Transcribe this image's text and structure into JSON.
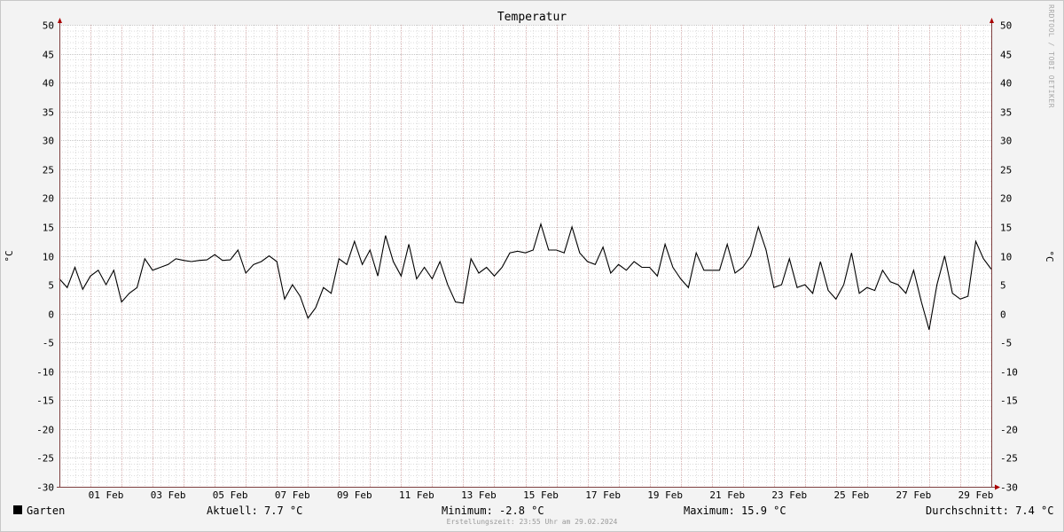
{
  "chart_data": {
    "type": "line",
    "title": "Temperatur",
    "ylabel": "°C",
    "ylabel_right": "°C",
    "ylim": [
      -30,
      50
    ],
    "ytick_step": 5,
    "xlim": [
      "2024-01-31",
      "2024-03-01"
    ],
    "x_ticks": [
      "01 Feb",
      "03 Feb",
      "05 Feb",
      "07 Feb",
      "09 Feb",
      "11 Feb",
      "13 Feb",
      "15 Feb",
      "17 Feb",
      "19 Feb",
      "21 Feb",
      "23 Feb",
      "25 Feb",
      "27 Feb",
      "29 Feb"
    ],
    "grid": true,
    "colors": {
      "line": "#000000",
      "minor_grid": "#c8c8c8",
      "major_grid_x": "#d9a3a3",
      "major_grid_y": "#b5b5b5",
      "axis": "#7f3f3f",
      "arrow": "#aa0000",
      "background": "#ffffff"
    },
    "series": [
      {
        "name": "Garten",
        "x": [
          "2024-01-31 00:00",
          "2024-01-31 06:00",
          "2024-01-31 12:00",
          "2024-01-31 18:00",
          "2024-02-01 00:00",
          "2024-02-01 06:00",
          "2024-02-01 12:00",
          "2024-02-01 18:00",
          "2024-02-02 00:00",
          "2024-02-02 06:00",
          "2024-02-02 12:00",
          "2024-02-02 18:00",
          "2024-02-03 00:00",
          "2024-02-03 06:00",
          "2024-02-03 12:00",
          "2024-02-03 18:00",
          "2024-02-04 00:00",
          "2024-02-04 06:00",
          "2024-02-04 12:00",
          "2024-02-04 18:00",
          "2024-02-05 00:00",
          "2024-02-05 06:00",
          "2024-02-05 12:00",
          "2024-02-05 18:00",
          "2024-02-06 00:00",
          "2024-02-06 06:00",
          "2024-02-06 12:00",
          "2024-02-06 18:00",
          "2024-02-07 00:00",
          "2024-02-07 06:00",
          "2024-02-07 12:00",
          "2024-02-07 18:00",
          "2024-02-08 00:00",
          "2024-02-08 06:00",
          "2024-02-08 12:00",
          "2024-02-08 18:00",
          "2024-02-09 00:00",
          "2024-02-09 06:00",
          "2024-02-09 12:00",
          "2024-02-09 18:00",
          "2024-02-10 00:00",
          "2024-02-10 06:00",
          "2024-02-10 12:00",
          "2024-02-10 18:00",
          "2024-02-11 00:00",
          "2024-02-11 06:00",
          "2024-02-11 12:00",
          "2024-02-11 18:00",
          "2024-02-12 00:00",
          "2024-02-12 06:00",
          "2024-02-12 12:00",
          "2024-02-12 18:00",
          "2024-02-13 00:00",
          "2024-02-13 06:00",
          "2024-02-13 12:00",
          "2024-02-13 18:00",
          "2024-02-14 00:00",
          "2024-02-14 06:00",
          "2024-02-14 12:00",
          "2024-02-14 18:00",
          "2024-02-15 00:00",
          "2024-02-15 06:00",
          "2024-02-15 12:00",
          "2024-02-15 18:00",
          "2024-02-16 00:00",
          "2024-02-16 06:00",
          "2024-02-16 12:00",
          "2024-02-16 18:00",
          "2024-02-17 00:00",
          "2024-02-17 06:00",
          "2024-02-17 12:00",
          "2024-02-17 18:00",
          "2024-02-18 00:00",
          "2024-02-18 06:00",
          "2024-02-18 12:00",
          "2024-02-18 18:00",
          "2024-02-19 00:00",
          "2024-02-19 06:00",
          "2024-02-19 12:00",
          "2024-02-19 18:00",
          "2024-02-20 00:00",
          "2024-02-20 06:00",
          "2024-02-20 12:00",
          "2024-02-20 18:00",
          "2024-02-21 00:00",
          "2024-02-21 06:00",
          "2024-02-21 12:00",
          "2024-02-21 18:00",
          "2024-02-22 00:00",
          "2024-02-22 06:00",
          "2024-02-22 12:00",
          "2024-02-22 18:00",
          "2024-02-23 00:00",
          "2024-02-23 06:00",
          "2024-02-23 12:00",
          "2024-02-23 18:00",
          "2024-02-24 00:00",
          "2024-02-24 06:00",
          "2024-02-24 12:00",
          "2024-02-24 18:00",
          "2024-02-25 00:00",
          "2024-02-25 06:00",
          "2024-02-25 12:00",
          "2024-02-25 18:00",
          "2024-02-26 00:00",
          "2024-02-26 06:00",
          "2024-02-26 12:00",
          "2024-02-26 18:00",
          "2024-02-27 00:00",
          "2024-02-27 06:00",
          "2024-02-27 12:00",
          "2024-02-27 18:00",
          "2024-02-28 00:00",
          "2024-02-28 06:00",
          "2024-02-28 12:00",
          "2024-02-28 18:00",
          "2024-02-29 00:00",
          "2024-02-29 06:00",
          "2024-02-29 12:00",
          "2024-02-29 18:00",
          "2024-02-29 23:55"
        ],
        "values": [
          6,
          4.5,
          8,
          4.2,
          6.5,
          7.5,
          5,
          7.5,
          2,
          3.5,
          4.5,
          9.5,
          7.5,
          8,
          8.5,
          9.5,
          9.2,
          9,
          9.2,
          9.3,
          10.2,
          9.2,
          9.3,
          11,
          7,
          8.5,
          9,
          10,
          9,
          2.5,
          5,
          3,
          -0.8,
          1,
          4.5,
          3.5,
          9.5,
          8.5,
          12.5,
          8.5,
          11,
          6.5,
          13.5,
          9,
          6.5,
          12,
          6,
          8,
          6,
          9,
          5,
          2,
          1.8,
          9.5,
          7,
          8,
          6.5,
          8,
          10.5,
          10.8,
          10.5,
          11,
          15.5,
          11,
          11,
          10.5,
          15,
          10.5,
          9,
          8.5,
          11.5,
          7,
          8.5,
          7.5,
          9,
          8,
          8,
          6.5,
          12,
          8,
          6,
          4.5,
          10.5,
          7.5,
          7.5,
          7.5,
          12,
          7,
          8,
          10,
          15,
          11,
          4.5,
          5,
          9.5,
          4.5,
          5,
          3.5,
          9,
          4,
          2.5,
          5,
          10.5,
          3.5,
          4.5,
          4,
          7.5,
          5.5,
          5,
          3.5,
          7.5,
          2,
          -2.8,
          5,
          10,
          3.5,
          2.5,
          3,
          12.5,
          9.5,
          7.7
        ]
      }
    ]
  },
  "legend": {
    "series_name": "Garten",
    "current": "Aktuell: 7.7 °C",
    "minimum": "Minimum: -2.8 °C",
    "maximum": "Maximum: 15.9 °C",
    "average": "Durchschnitt: 7.4 °C"
  },
  "footer": {
    "created": "Erstellungszeit: 23:55 Uhr am 29.02.2024"
  },
  "credit": "RRDTOOL / TOBI OETIKER"
}
